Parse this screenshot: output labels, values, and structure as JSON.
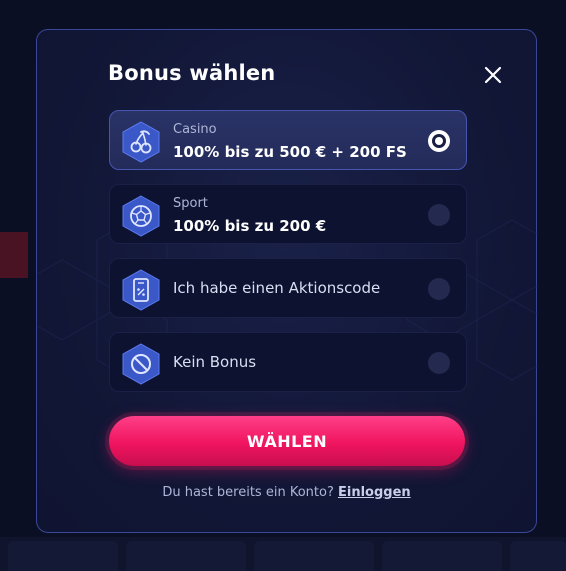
{
  "modal": {
    "title": "Bonus wählen",
    "close_icon": "close-icon"
  },
  "options": [
    {
      "id": "casino",
      "icon": "cherry-icon",
      "label": "Casino",
      "value": "100% bis zu 500 € + 200 FS",
      "selected": true
    },
    {
      "id": "sport",
      "icon": "soccer-ball-icon",
      "label": "Sport",
      "value": "100% bis zu 200 €",
      "selected": false
    },
    {
      "id": "promo",
      "icon": "promo-code-icon",
      "label": "Ich habe einen Aktionscode",
      "selected": false
    },
    {
      "id": "none",
      "icon": "no-bonus-icon",
      "label": "Kein Bonus",
      "selected": false
    }
  ],
  "submit": {
    "label": "WÄHLEN"
  },
  "footer": {
    "text": "Du hast bereits ein Konto?",
    "link": "Einloggen"
  },
  "colors": {
    "accent": "#f0145f",
    "modal_border": "#3a4699",
    "selected_bg": "#2a3366",
    "icon_blue": "#3b58c9"
  }
}
